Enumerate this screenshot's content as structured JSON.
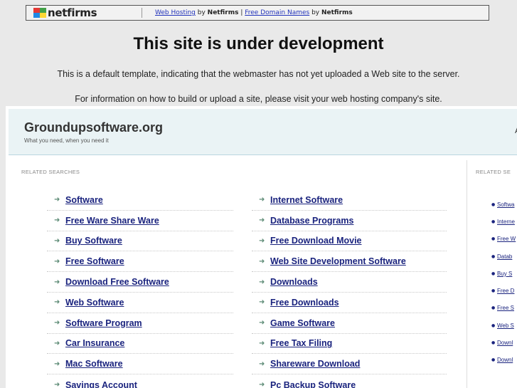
{
  "banner": {
    "logo_text": "netfirms",
    "link1": "Web Hosting",
    "by1": " by ",
    "brand1": "Netfirms",
    "sep": " | ",
    "link2": "Free Domain Names",
    "by2": " by ",
    "brand2": "Netfirms"
  },
  "page": {
    "title": "This site is under development",
    "info1": "This is a default template, indicating that the webmaster has not yet uploaded a Web site to the server.",
    "info2": "For information on how to build or upload a site, please visit your web hosting company's site."
  },
  "park": {
    "domain": "Groundupsoftware.org",
    "tagline": "What you need, when you need it",
    "header_right": "A",
    "related_label": "RELATED SEARCHES",
    "side_label": "RELATED SE",
    "left_links": [
      "Software",
      "Free Ware Share Ware",
      "Buy Software",
      "Free Software",
      "Download Free Software",
      "Web Software",
      "Software Program",
      "Car Insurance",
      "Mac Software",
      "Savings Account"
    ],
    "right_links": [
      "Internet Software",
      "Database Programs",
      "Free Download Movie",
      "Web Site Development Software",
      "Downloads",
      "Free Downloads",
      "Game Software",
      "Free Tax Filing",
      "Shareware Download",
      "Pc Backup Software"
    ],
    "side_links": [
      "Softwa",
      "Interne",
      "Free W",
      "Datab",
      "Buy S",
      "Free D",
      "Free S",
      "Web S",
      "Downl",
      "Downl"
    ]
  }
}
